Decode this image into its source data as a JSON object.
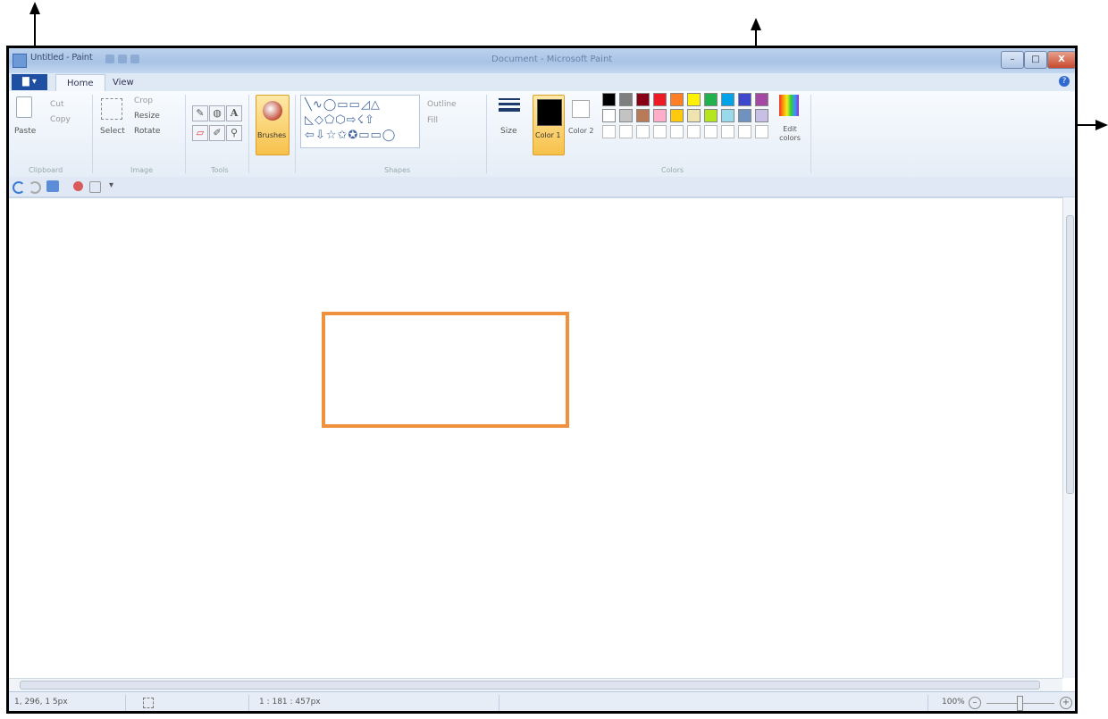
{
  "title_bar": {
    "title": "Untitled - Paint",
    "center_text": "Document - Microsoft Paint"
  },
  "window_controls": {
    "minimize": "–",
    "maximize": "□",
    "close": "X"
  },
  "tabs": {
    "file": "▇ ▾",
    "home": "Home",
    "view": "View"
  },
  "help_icon": "?",
  "ribbon": {
    "clipboard": {
      "paste": "Paste",
      "cut": "Cut",
      "copy": "Copy",
      "label": "Clipboard"
    },
    "image": {
      "select": "Select",
      "crop": "Crop",
      "resize": "Resize",
      "rotate": "Rotate",
      "label": "Image"
    },
    "tools": {
      "label": "Tools",
      "pencil": "✎",
      "fill": "◍",
      "text": "A",
      "eraser": "▱",
      "picker": "✐",
      "magnifier": "⚲"
    },
    "brushes": {
      "label": "Brushes"
    },
    "shapes": {
      "row1": "╲∿◯▭▭◿△",
      "row2": "◺◇⬠⬡⇨☇⇧",
      "row3": "⇦⇩☆✩✪▭▭◯",
      "outline": "Outline",
      "fill": "Fill",
      "label": "Shapes"
    },
    "size": {
      "label": "Size"
    },
    "color1": {
      "label": "Color 1"
    },
    "color2": {
      "label": "Color 2"
    },
    "colors_label": "Colors",
    "edit_colors": "Edit colors",
    "palette_row1": [
      "#000000",
      "#7f7f7f",
      "#880015",
      "#ed1c24",
      "#ff7f27",
      "#fff200",
      "#22b14c",
      "#00a2e8",
      "#3f48cc",
      "#a349a4"
    ],
    "palette_row2": [
      "#ffffff",
      "#c3c3c3",
      "#b97a57",
      "#ffaec9",
      "#ffc90e",
      "#efe4b0",
      "#b5e61d",
      "#99d9ea",
      "#7092be",
      "#c8bfe7"
    ]
  },
  "status": {
    "position": "1, 296, 1 5px",
    "selection": "",
    "size": "1 : 181 : 457px",
    "zoom": "100%"
  }
}
